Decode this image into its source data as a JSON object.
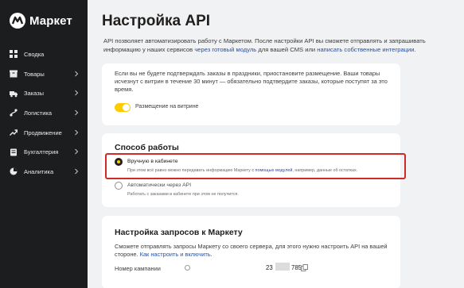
{
  "sidebar": {
    "logo_text": "Маркет",
    "items": [
      {
        "label": "Сводка",
        "icon": "squares-icon",
        "chevron": false
      },
      {
        "label": "Товары",
        "icon": "box-icon",
        "chevron": true
      },
      {
        "label": "Заказы",
        "icon": "truck-icon",
        "chevron": true
      },
      {
        "label": "Логистика",
        "icon": "route-icon",
        "chevron": true
      },
      {
        "label": "Продвижение",
        "icon": "growth-icon",
        "chevron": true
      },
      {
        "label": "Бухгалтерия",
        "icon": "ledger-icon",
        "chevron": true
      },
      {
        "label": "Аналитика",
        "icon": "chart-icon",
        "chevron": true
      }
    ]
  },
  "page": {
    "title": "Настройка API",
    "intro_1": "API позволяет автоматизировать работу с Маркетом. После настройки API вы сможете отправлять и запрашивать информацию у наших сервисов ",
    "intro_link_1": "через готовый модуль",
    "intro_2": " для вашей CMS или ",
    "intro_link_2": "написать собственные интеграции",
    "intro_3": "."
  },
  "notice_card": {
    "text": "Если вы не будете подтверждать заказы в праздники, приостановите размещение. Ваши товары исчезнут с витрин в течение 30 минут — обязательно подтвердите заказы, которые поступят за это время.",
    "toggle_label": "Размещение на витрине",
    "toggle_on": true
  },
  "work_mode": {
    "title": "Способ работы",
    "options": [
      {
        "label": "Вручную в кабинете",
        "selected": true,
        "desc_1": "При этом всё равно можно передавать информацию Маркету ",
        "desc_link": "с помощью модулей",
        "desc_2": ", например, данные об остатках."
      },
      {
        "label": "Автоматически через API",
        "selected": false,
        "desc_1": "Работать с заказами в кабинете при этом не получится."
      }
    ]
  },
  "requests": {
    "title": "Настройка запросов к Маркету",
    "text": "Сможете отправлять запросы Маркету со своего сервера, для этого нужно настроить API на вашей стороне. ",
    "link": "Как настроить и включить",
    "text_end": ".",
    "field_label": "Номер кампании",
    "campaign_prefix": "23",
    "campaign_suffix": "785"
  },
  "colors": {
    "sidebar_bg": "#1c1d1f",
    "accent": "#ffcc00",
    "link": "#2650a6",
    "highlight": "#cf2a2a"
  }
}
